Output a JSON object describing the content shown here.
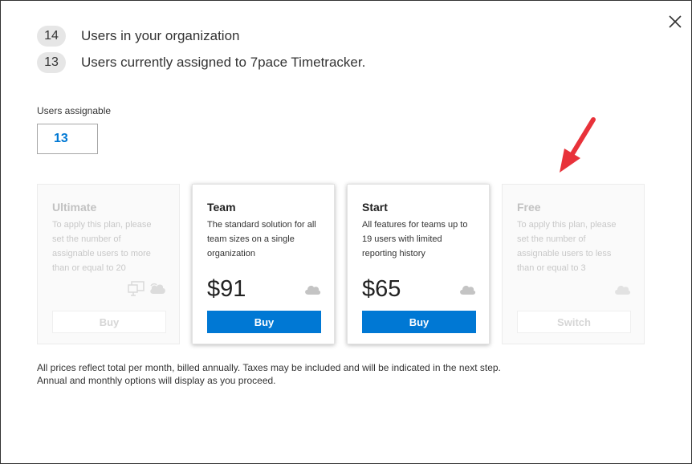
{
  "stats": [
    {
      "count": "14",
      "label": "Users in your organization"
    },
    {
      "count": "13",
      "label": "Users currently assigned to 7pace Timetracker."
    }
  ],
  "assignable": {
    "label": "Users assignable",
    "value": "13"
  },
  "plans": [
    {
      "title": "Ultimate",
      "description": "To apply this plan, please set the number of assignable users to more than or equal to 20",
      "price": "",
      "button": "Buy",
      "state": "disabled",
      "icons": [
        "devices-icon",
        "cloud-icon"
      ]
    },
    {
      "title": "Team",
      "description": "The standard solution for all team sizes on a single organization",
      "price": "$91",
      "button": "Buy",
      "state": "enabled",
      "icons": [
        "cloud-icon"
      ]
    },
    {
      "title": "Start",
      "description": "All features for teams up to 19 users with limited reporting history",
      "price": "$65",
      "button": "Buy",
      "state": "enabled",
      "icons": [
        "cloud-icon"
      ]
    },
    {
      "title": "Free",
      "description": "To apply this plan, please set the number of assignable users to less than or equal to 3",
      "price": "",
      "button": "Switch",
      "state": "disabled",
      "icons": [
        "cloud-icon"
      ]
    }
  ],
  "footnote": {
    "line1": "All prices reflect total per month, billed annually. Taxes may be included and will be indicated in the next step.",
    "line2": "Annual and monthly options will display as you proceed."
  },
  "colors": {
    "primary": "#0078d4",
    "arrow": "#e8323a",
    "badge_bg": "#e6e6e6"
  }
}
